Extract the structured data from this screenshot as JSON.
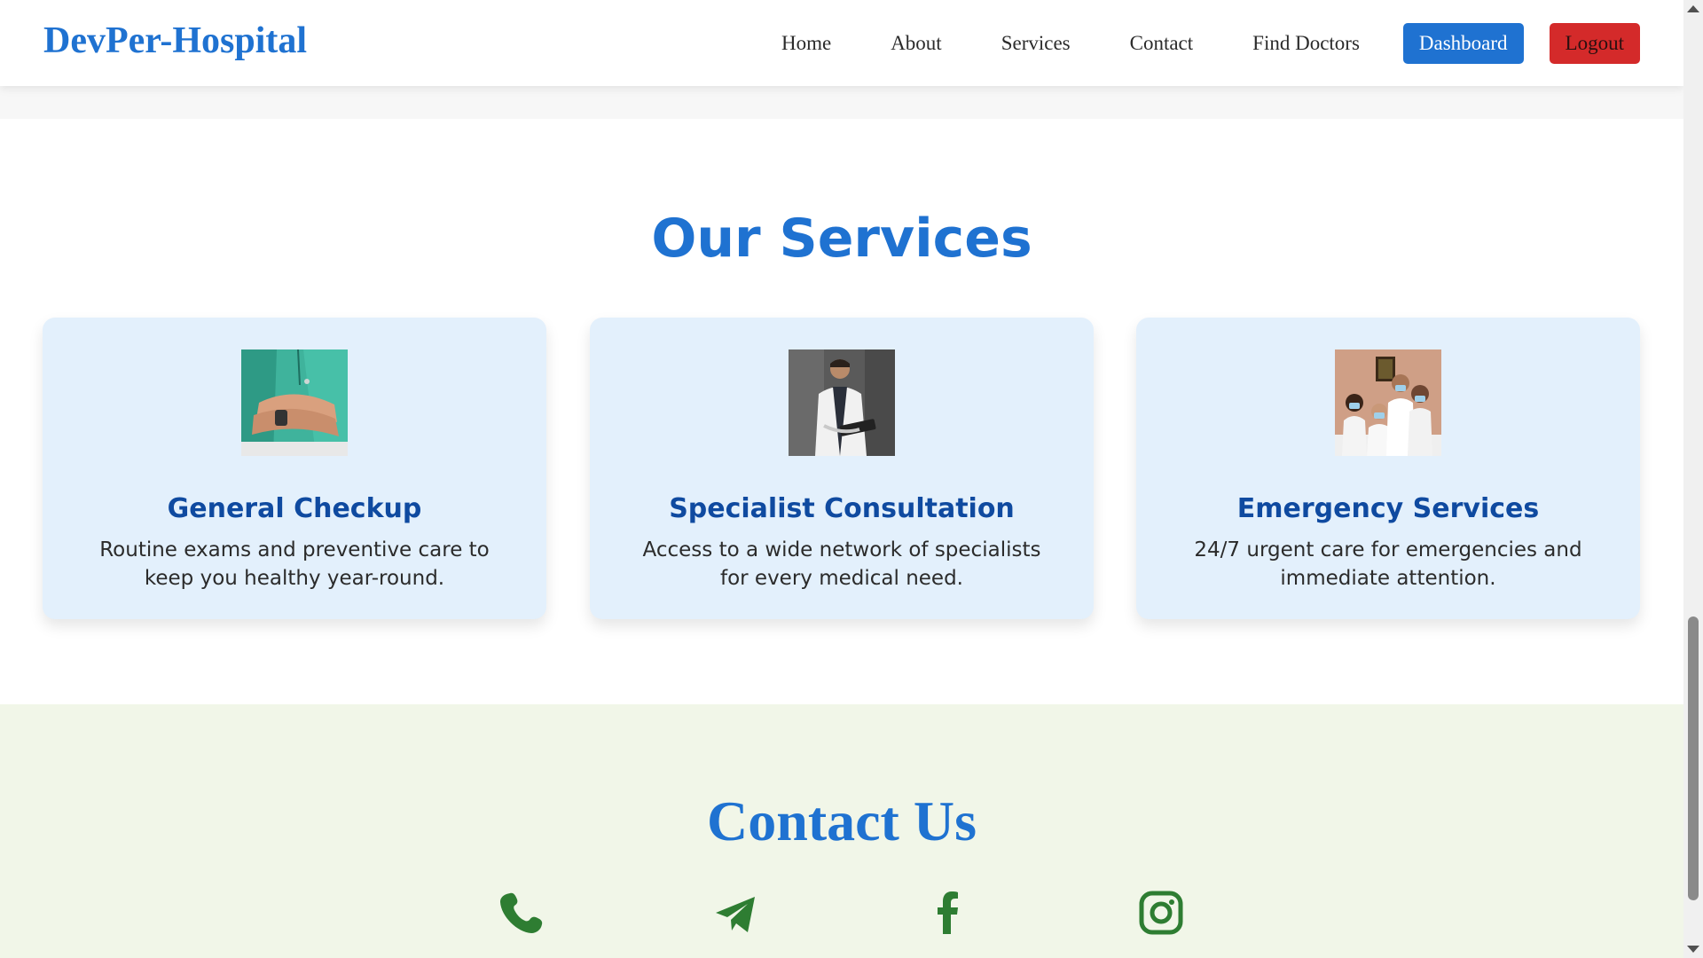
{
  "brand": "DevPer-Hospital",
  "nav": {
    "home": "Home",
    "about": "About",
    "services": "Services",
    "contact": "Contact",
    "find_doctors": "Find Doctors",
    "dashboard": "Dashboard",
    "logout": "Logout"
  },
  "services": {
    "title": "Our Services",
    "cards": [
      {
        "title": "General Checkup",
        "description": "Routine exams and preventive care to keep you healthy year-round.",
        "image": "doctor-arms-crossed-photo"
      },
      {
        "title": "Specialist Consultation",
        "description": "Access to a wide network of specialists for every medical need.",
        "image": "doctor-with-tablet-photo"
      },
      {
        "title": "Emergency Services",
        "description": "24/7 urgent care for emergencies and immediate attention.",
        "image": "masked-medical-team-photo"
      }
    ]
  },
  "contact": {
    "title": "Contact Us",
    "icons": [
      "phone-icon",
      "telegram-icon",
      "facebook-icon",
      "instagram-icon"
    ]
  },
  "colors": {
    "brand_blue": "#1f72d1",
    "card_title": "#0f4aa0",
    "card_bg": "#e3f0fc",
    "logout_red": "#d42a2a",
    "contact_bg": "#f1f6e8",
    "icon_green": "#2e7d32"
  }
}
